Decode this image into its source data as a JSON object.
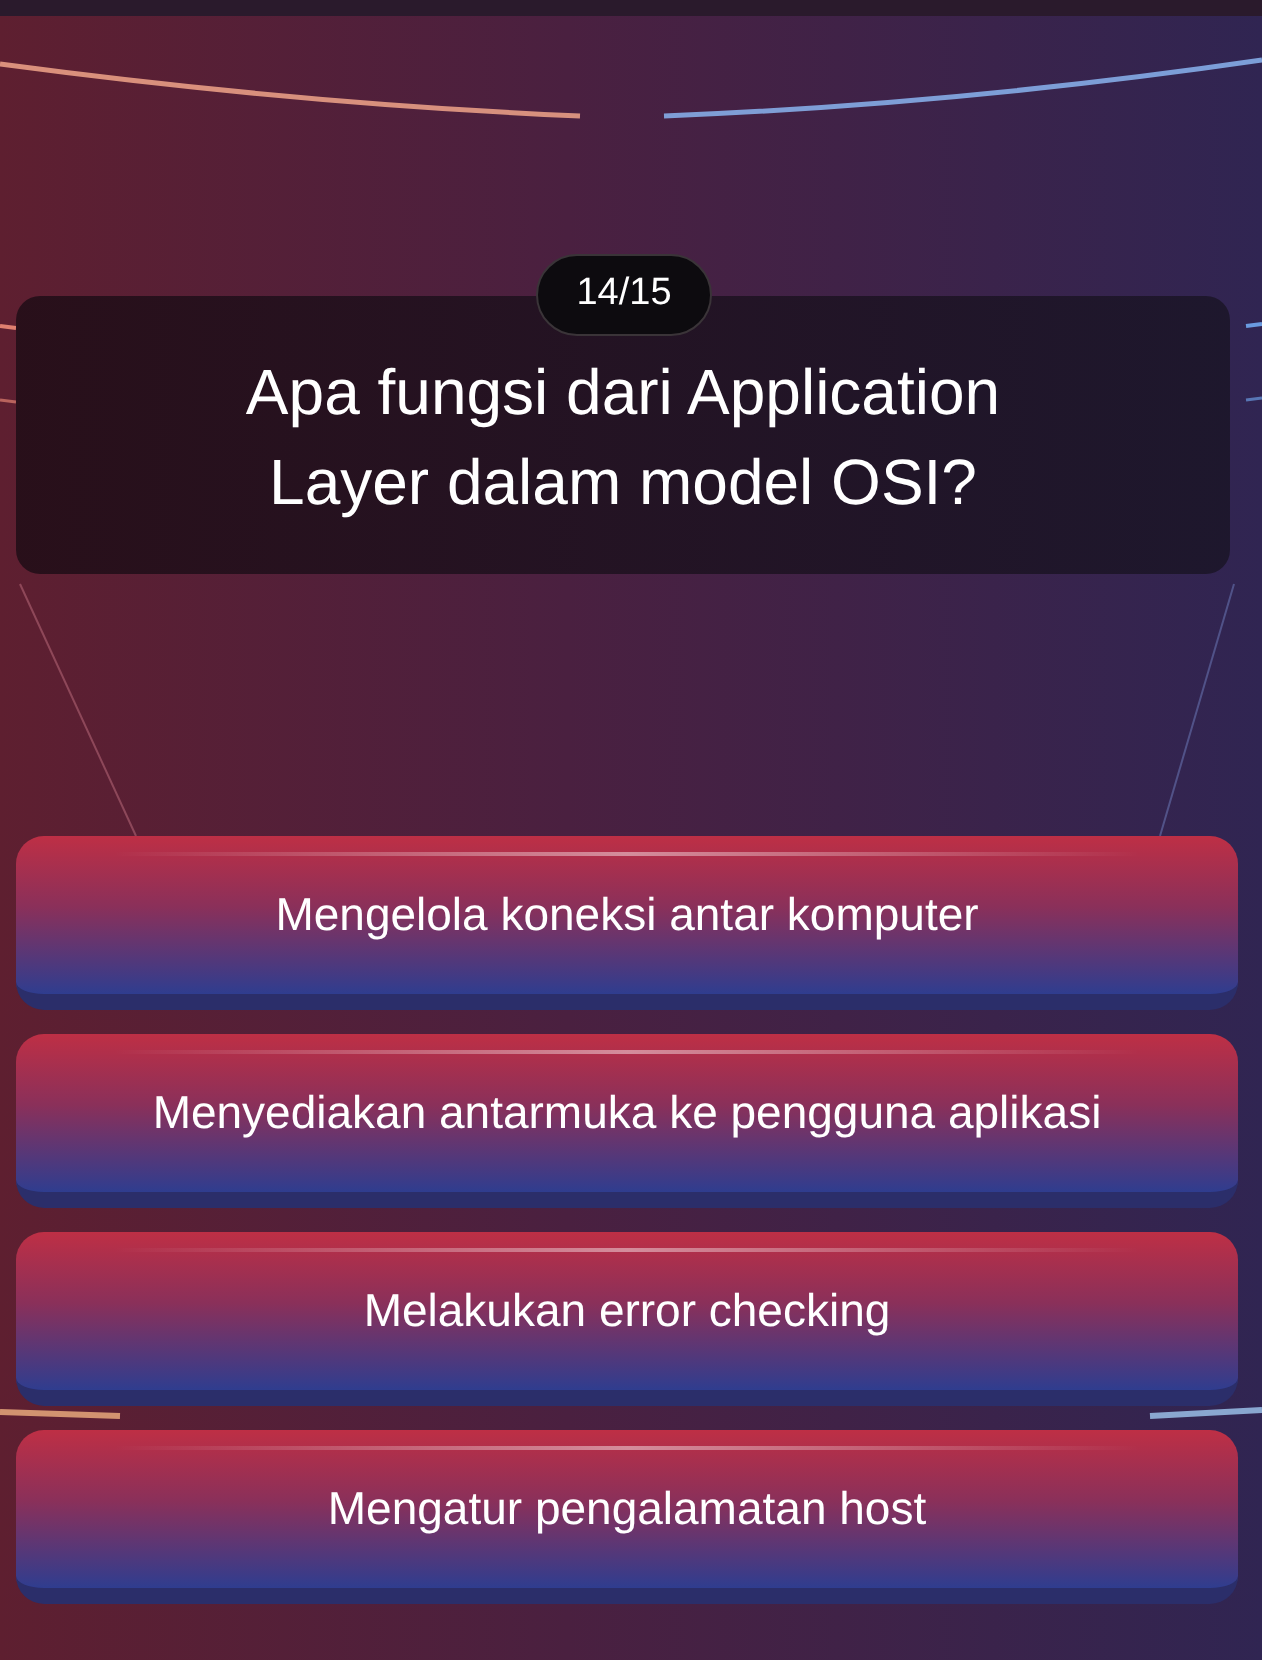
{
  "progress": {
    "counter": "14/15"
  },
  "question": {
    "text": "Apa fungsi dari Application Layer dalam model OSI?"
  },
  "answers": [
    {
      "text": "Mengelola koneksi antar komputer",
      "selected": false
    },
    {
      "text": "Menyediakan antarmuka ke pengguna aplikasi",
      "selected": false
    },
    {
      "text": "Melakukan error checking",
      "selected": false
    },
    {
      "text": "Mengatur pengalamatan host",
      "selected": false
    }
  ]
}
